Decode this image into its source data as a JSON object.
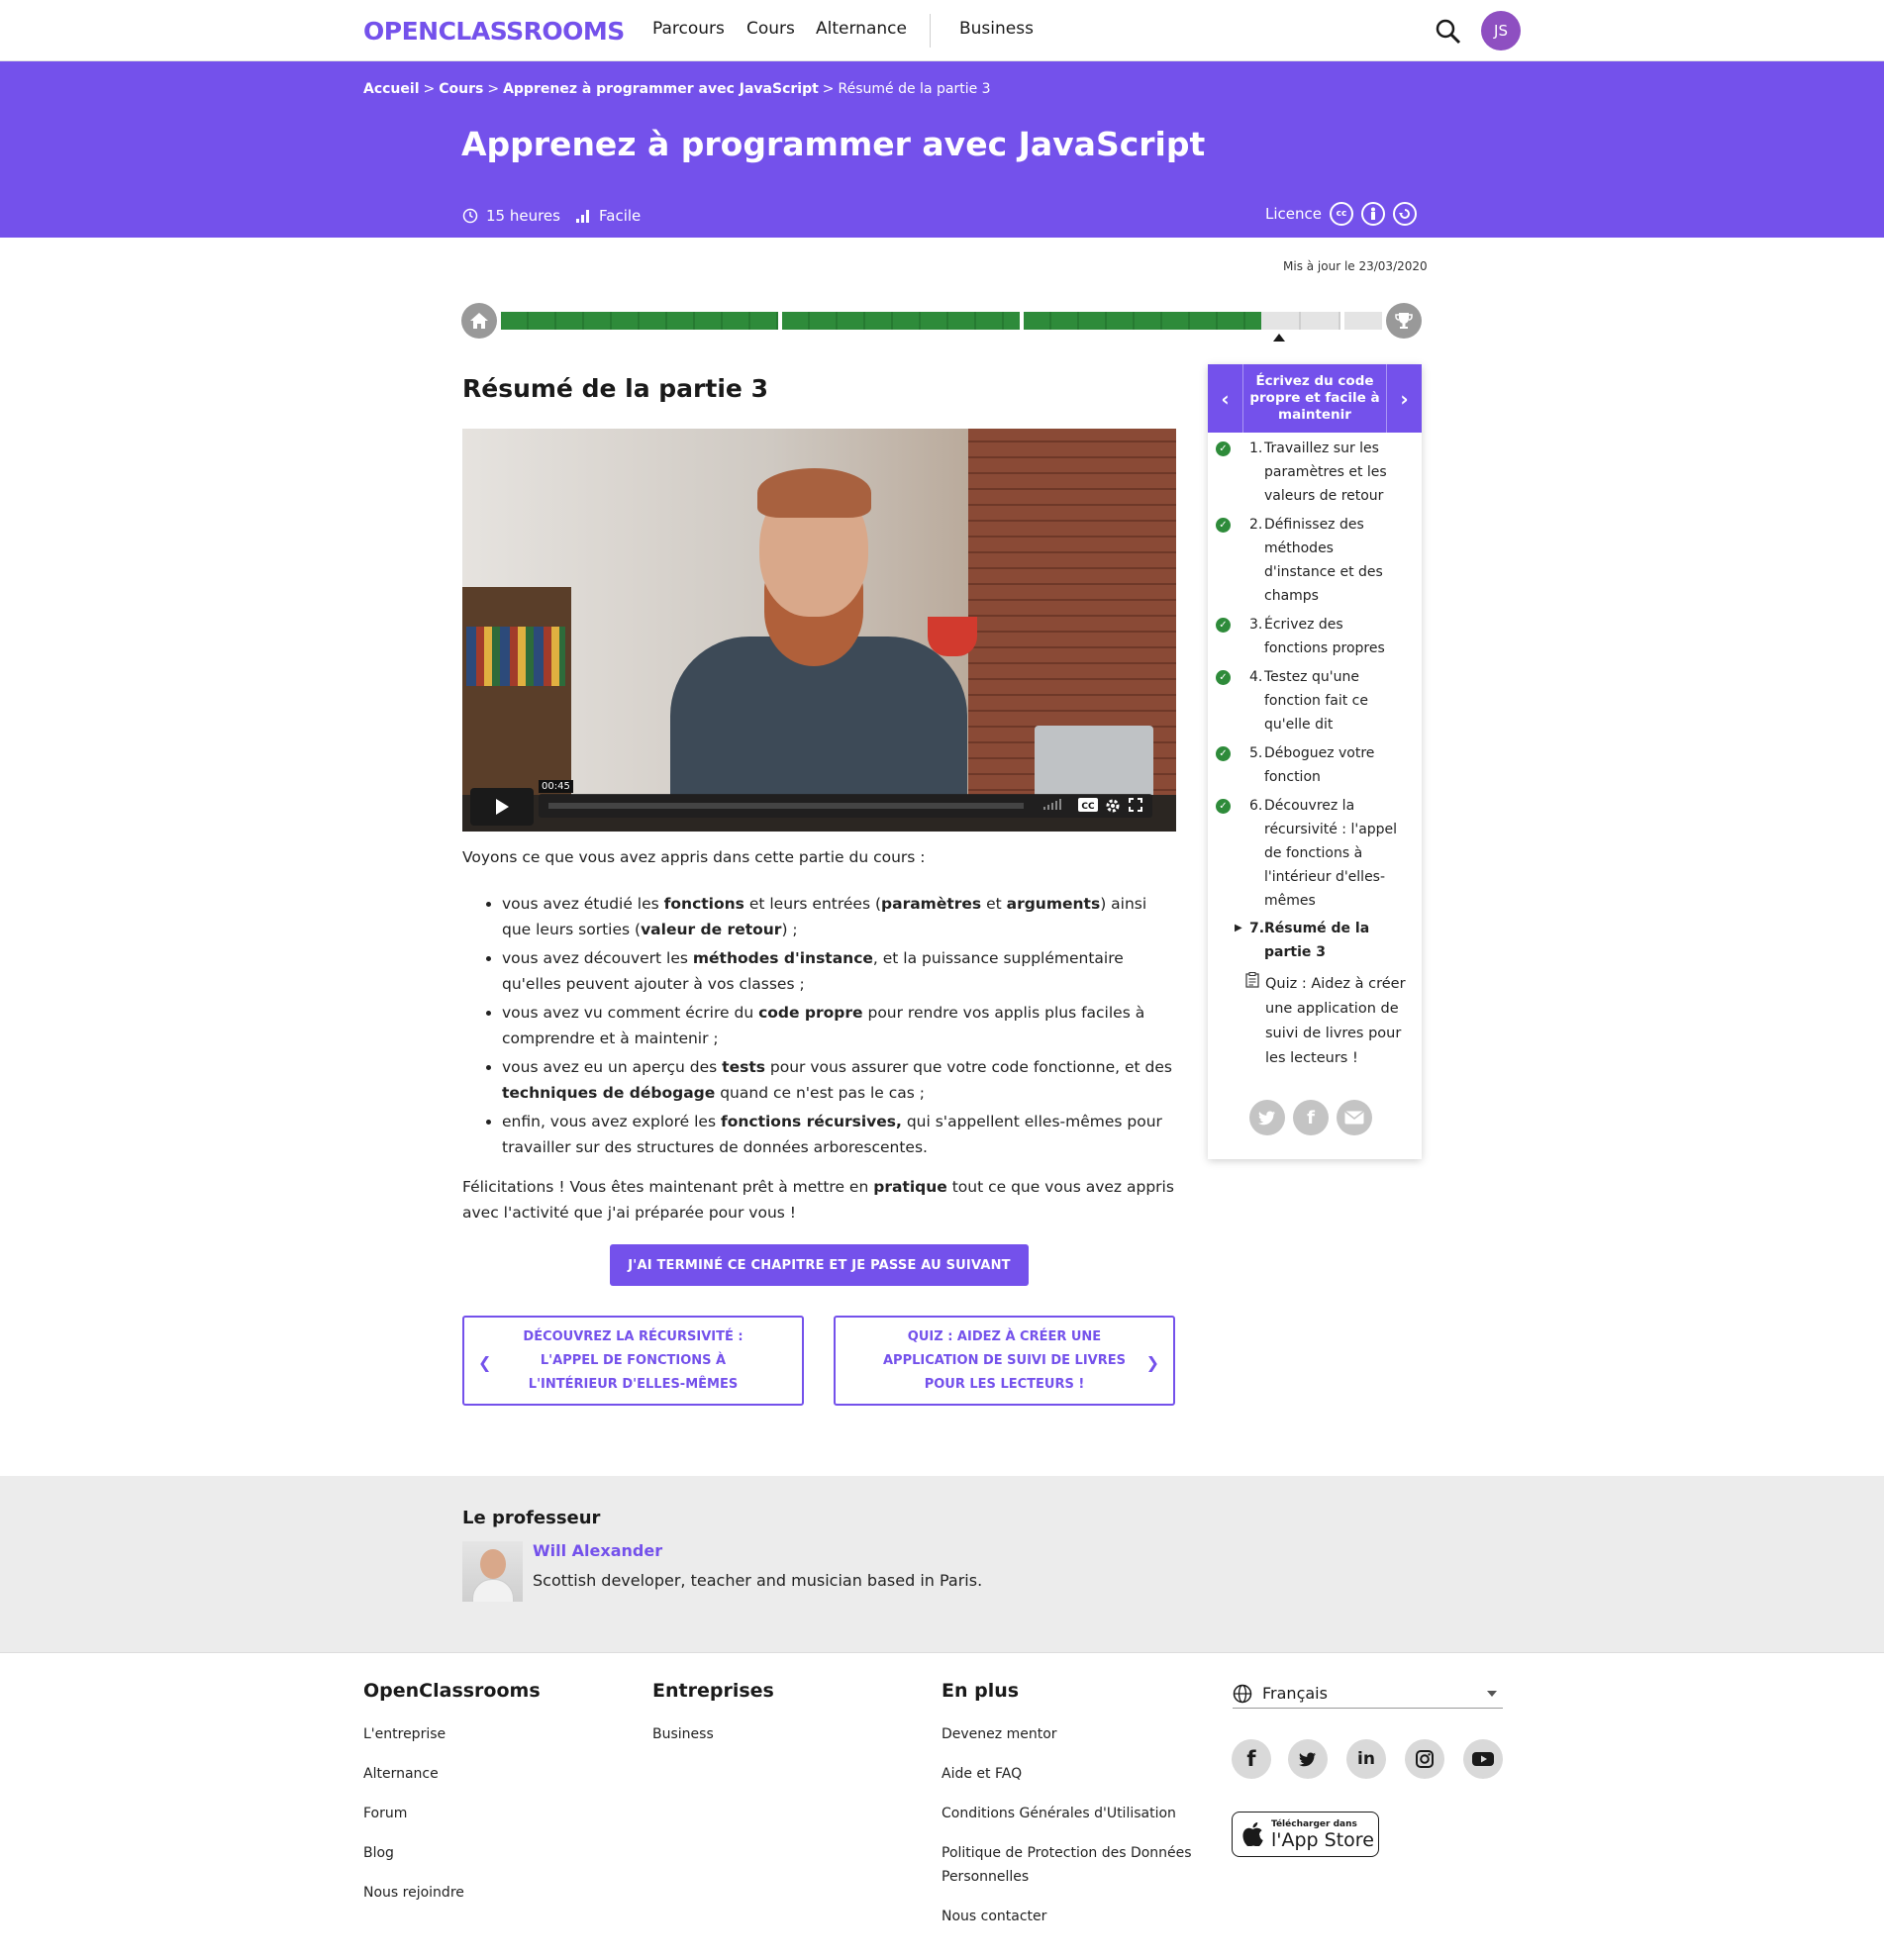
{
  "header": {
    "logo": "OPENCLASSROOMS",
    "nav": [
      "Parcours",
      "Cours",
      "Alternance",
      "Business"
    ],
    "avatar_initials": "JS"
  },
  "hero": {
    "breadcrumb": {
      "home": "Accueil",
      "courses": "Cours",
      "course": "Apprenez à programmer avec JavaScript",
      "current": "Résumé de la partie 3"
    },
    "title": "Apprenez à programmer avec JavaScript",
    "duration": "15 heures",
    "level": "Facile",
    "licence_label": "Licence"
  },
  "updated": "Mis à jour le 23/03/2020",
  "progress": {
    "completed_fraction": 0.82
  },
  "main": {
    "chapter_title": "Résumé de la partie 3",
    "video": {
      "time_tip": "00:45"
    },
    "intro": "Voyons ce que vous avez appris dans cette partie du cours :",
    "bullets": [
      [
        "vous avez étudié les ",
        "fonctions",
        " et leurs entrées (",
        "paramètres",
        " et ",
        "arguments",
        ") ainsi que leurs sorties (",
        "valeur de retour",
        ") ;"
      ],
      [
        "vous avez découvert les ",
        "méthodes d'instance",
        ", et la puissance supplémentaire qu'elles peuvent ajouter à vos classes ;"
      ],
      [
        "vous avez vu comment écrire du ",
        "code propre",
        " pour rendre vos applis plus faciles à comprendre et à maintenir ;"
      ],
      [
        "vous avez eu un aperçu des ",
        "tests",
        " pour vous assurer que votre code fonctionne, et des ",
        "techniques de débogage",
        " quand ce n'est pas le cas ;"
      ],
      [
        "enfin, vous avez exploré les ",
        "fonctions récursives,",
        " qui s'appellent elles-mêmes pour travailler sur des structures de données arborescentes."
      ]
    ],
    "congrats": {
      "a": "Félicitations ! Vous êtes maintenant prêt à mettre en ",
      "b": "pratique",
      "c": " tout ce que vous avez appris avec l'activité que j'ai préparée pour vous !"
    },
    "done_button": "J'AI TERMINÉ CE CHAPITRE ET JE PASSE AU SUIVANT",
    "prev_card": "DÉCOUVREZ LA RÉCURSIVITÉ : L'APPEL DE FONCTIONS À L'INTÉRIEUR D'ELLES-MÊMES",
    "next_card": "QUIZ : AIDEZ À CRÉER UNE APPLICATION DE SUIVI DE LIVRES POUR LES LECTEURS !"
  },
  "sidebar": {
    "section_title": "Écrivez du code propre et facile à maintenir",
    "items": [
      {
        "num": "1.",
        "label": "Travaillez sur les paramètres et les valeurs de retour",
        "done": true
      },
      {
        "num": "2.",
        "label": "Définissez des méthodes d'instance et des champs",
        "done": true
      },
      {
        "num": "3.",
        "label": "Écrivez des fonctions propres",
        "done": true
      },
      {
        "num": "4.",
        "label": "Testez qu'une fonction fait ce qu'elle dit",
        "done": true
      },
      {
        "num": "5.",
        "label": "Déboguez votre fonction",
        "done": true
      },
      {
        "num": "6.",
        "label": "Découvrez la récursivité : l'appel de fonctions à l'intérieur d'elles-mêmes",
        "done": true
      },
      {
        "num": "7.",
        "label": "Résumé de la partie 3",
        "done": false,
        "current": true
      }
    ],
    "quiz": "Quiz : Aidez à créer une application de suivi de livres pour les lecteurs !"
  },
  "teacher": {
    "label": "Le professeur",
    "name": "Will Alexander",
    "bio": "Scottish developer, teacher and musician based in Paris."
  },
  "footer": {
    "col1": {
      "title": "OpenClassrooms",
      "links": [
        "L'entreprise",
        "Alternance",
        "Forum",
        "Blog",
        "Nous rejoindre"
      ]
    },
    "col2": {
      "title": "Entreprises",
      "links": [
        "Business"
      ]
    },
    "col3": {
      "title": "En plus",
      "links": [
        "Devenez mentor",
        "Aide et FAQ",
        "Conditions Générales d'Utilisation",
        "Politique de Protection des Données Personnelles",
        "Nous contacter"
      ]
    },
    "language": "Français",
    "appstore_small": "Télécharger dans",
    "appstore_large": "l'App Store"
  },
  "colors": {
    "accent": "#7451eb",
    "done_green": "#2e8b3a",
    "progress_green": "#2e8b3a"
  }
}
